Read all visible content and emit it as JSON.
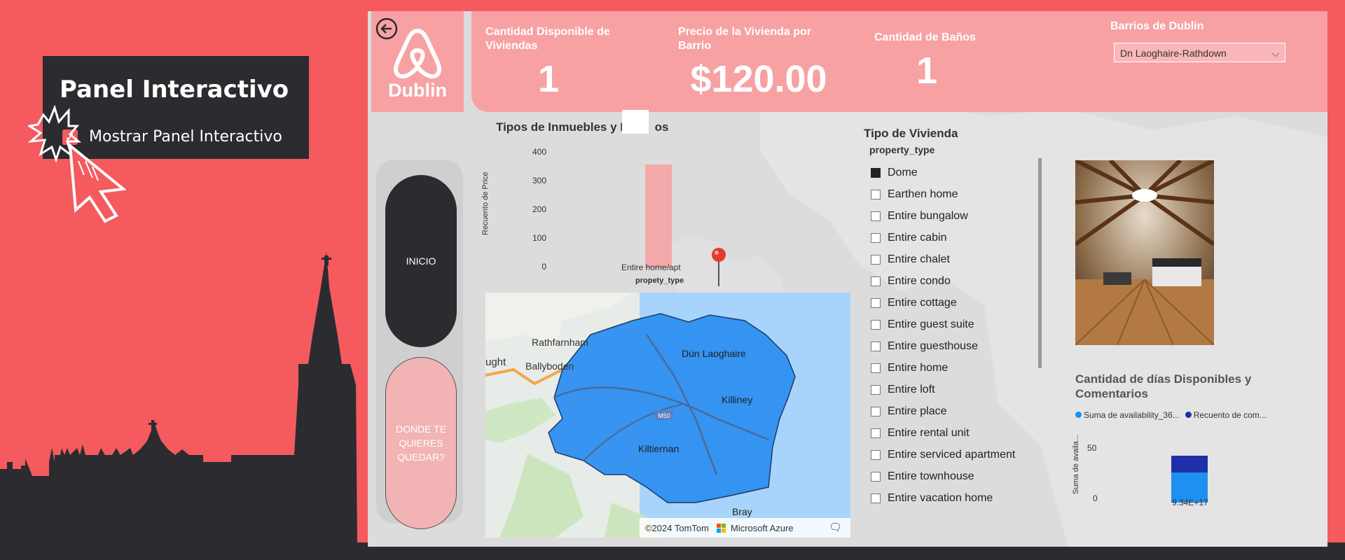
{
  "panel": {
    "title": "Panel Interactivo",
    "checkbox_label": "Mostrar Panel Interactivo",
    "checked": true
  },
  "header": {
    "logo_text": "Dublin",
    "kpis": [
      {
        "title": "Cantidad Disponible de Viviendas",
        "value": "1"
      },
      {
        "title": "Precio de la Vivienda por Barrio",
        "value": "$120.00"
      },
      {
        "title": "Cantidad de Baños",
        "value": "1"
      }
    ],
    "barrio_filter": {
      "label": "Barrios de Dublin",
      "value": "Dn Laoghaire-Rathdown"
    }
  },
  "nav": {
    "inicio": "INICIO",
    "donde": "DONDE TE QUIERES QUEDAR?"
  },
  "bar_chart": {
    "title": "Tipos de Inmuebles y P",
    "title_suffix": "os",
    "y_axis_label": "Recuento de Price",
    "x_axis_label": "propety_type",
    "ticks": [
      "400",
      "300",
      "200",
      "100",
      "0"
    ]
  },
  "map": {
    "labels": [
      "Rathfarnham",
      "ught",
      "Ballyboden",
      "Dún Laoghaire",
      "Killiney",
      "Kiltiernan",
      "Bray",
      "M50"
    ],
    "attribution": "©2024 TomTom",
    "provider": "Microsoft Azure"
  },
  "slicer": {
    "title": "Tipo de Vivienda",
    "field": "property_type",
    "items": [
      {
        "label": "Dome",
        "checked": true
      },
      {
        "label": "Earthen home",
        "checked": false
      },
      {
        "label": "Entire bungalow",
        "checked": false
      },
      {
        "label": "Entire cabin",
        "checked": false
      },
      {
        "label": "Entire chalet",
        "checked": false
      },
      {
        "label": "Entire condo",
        "checked": false
      },
      {
        "label": "Entire cottage",
        "checked": false
      },
      {
        "label": "Entire guest suite",
        "checked": false
      },
      {
        "label": "Entire guesthouse",
        "checked": false
      },
      {
        "label": "Entire home",
        "checked": false
      },
      {
        "label": "Entire loft",
        "checked": false
      },
      {
        "label": "Entire place",
        "checked": false
      },
      {
        "label": "Entire rental unit",
        "checked": false
      },
      {
        "label": "Entire serviced apartment",
        "checked": false
      },
      {
        "label": "Entire townhouse",
        "checked": false
      },
      {
        "label": "Entire vacation home",
        "checked": false
      }
    ]
  },
  "mini_chart": {
    "title": "Cantidad de días Disponibles y Comentarios",
    "legend": [
      "Suma de availability_36...",
      "Recuento de com..."
    ],
    "y_axis_label": "Suma de availa...",
    "ticks": [
      "50",
      "0"
    ],
    "x_label": "9.34E+17"
  },
  "chart_data": [
    {
      "type": "bar",
      "title": "Tipos de Inmuebles y P os",
      "categories": [
        "Entire home/apt"
      ],
      "values": [
        360
      ],
      "xlabel": "propety_type",
      "ylabel": "Recuento de Price",
      "ylim": [
        0,
        400
      ],
      "color": "#f4a9ab"
    },
    {
      "type": "bar",
      "title": "Cantidad de días Disponibles y Comentarios",
      "categories": [
        "9.34E+17"
      ],
      "series": [
        {
          "name": "Suma de availability_36...",
          "values": [
            30
          ],
          "color": "#1e90f0"
        },
        {
          "name": "Recuento de com...",
          "values": [
            17
          ],
          "color": "#1f2fa8"
        }
      ],
      "ylabel": "Suma de availa...",
      "ylim": [
        0,
        60
      ]
    }
  ],
  "colors": {
    "brand_pink": "#f7a1a3",
    "background_red": "#f45a5e",
    "dark": "#2b2b30",
    "map_blue": "#2e8ff0"
  }
}
